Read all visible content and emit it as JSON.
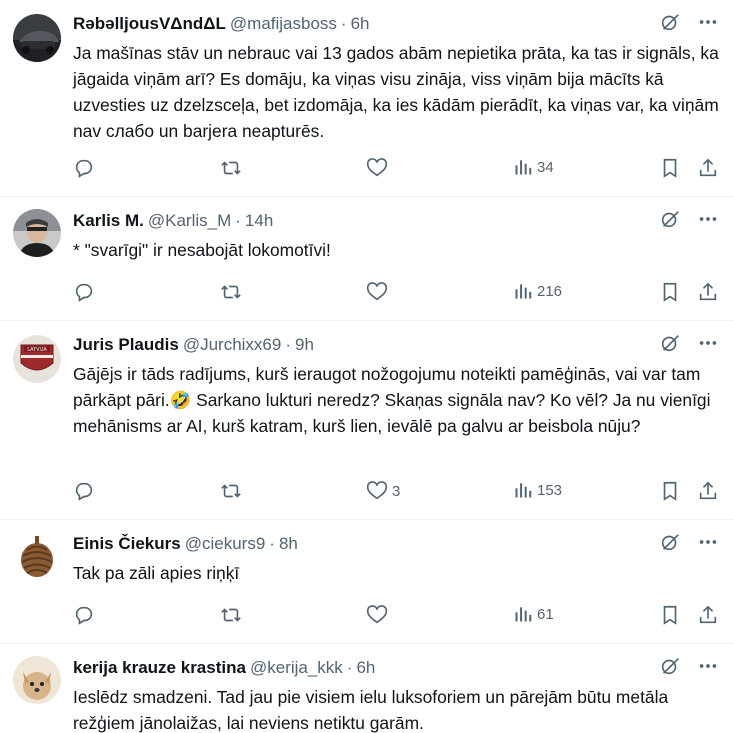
{
  "tweets": [
    {
      "name": "RəbəlljousVΔndΔL",
      "handle": "@mafijasboss",
      "time": "6h",
      "text": "Ja mašīnas stāv un nebrauc vai 13 gados abām nepietika prāta, ka tas ir signāls, ka jāgaida viņām arī? Es domāju, ka viņas visu zināja, viss viņām bija mācīts kā uzvesties uz dzelzsceļa, bet izdomāja, ka ies kādām pierādīt, ka viņas var, ka viņām nav слабо un barjera neapturēs.",
      "likes": "",
      "views": "34"
    },
    {
      "name": "Karlis M.",
      "handle": "@Karlis_M",
      "time": "14h",
      "text": "* \"svarīgi\" ir nesabojāt lokomotīvi!",
      "likes": "",
      "views": "216"
    },
    {
      "name": "Juris Plaudis",
      "handle": "@Jurchixx69",
      "time": "9h",
      "text": "Gājējs ir tāds radījums, kurš ieraugot nožogojumu noteikti pamēģinās, vai var tam pārkāpt pāri.🤣 Sarkano lukturi neredz? Skaņas signāla nav? Ko vēl? Ja nu vienīgi mehānisms ar AI, kurš katram, kurš lien, ievālē pa galvu ar beisbola nūju?",
      "likes": "3",
      "views": "153",
      "avatar_text": "LATVIJA"
    },
    {
      "name": "Einis Čiekurs",
      "handle": "@ciekurs9",
      "time": "8h",
      "text": "Tak pa zāli apies riņķī",
      "likes": "",
      "views": "61"
    },
    {
      "name": "kerija krauze krastina",
      "handle": "@kerija_kkk",
      "time": "6h",
      "text": "Ieslēdz smadzeni. Tad jau pie visiem ielu luksoforiem un pārejām būtu metāla režģiem jānolaižas, lai neviens netiktu garām.",
      "likes": "",
      "views": ""
    }
  ],
  "colors": {
    "text": "#0f1419",
    "muted": "#536471",
    "divider": "#eff3f4"
  },
  "icons": [
    "grok-icon",
    "more-icon",
    "reply-icon",
    "retweet-icon",
    "like-icon",
    "views-icon",
    "bookmark-icon",
    "share-icon"
  ]
}
